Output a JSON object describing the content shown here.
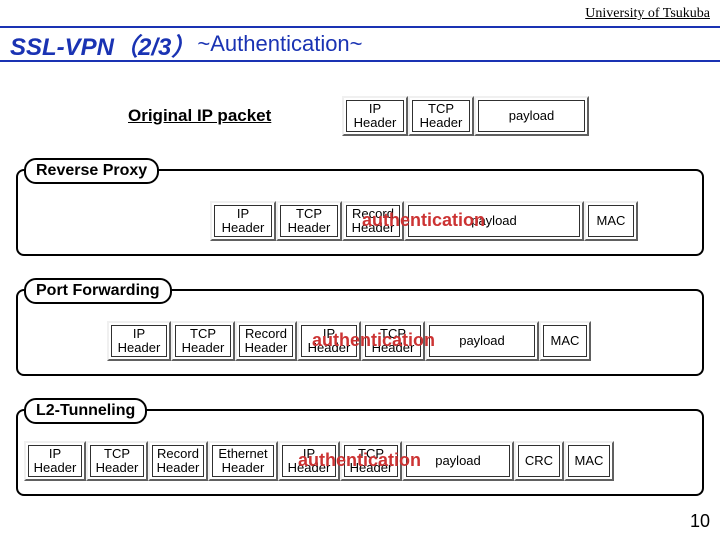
{
  "university": "University of Tsukuba",
  "title_main": "SSL-VPN",
  "title_part": "（2/3）",
  "title_sub": "~Authentication~",
  "page_number": "10",
  "original_label": "Original  IP packet",
  "cells": {
    "ip": "IP Header",
    "tcp": "TCP Header",
    "payload": "payload",
    "record": "Record Header",
    "mac": "MAC",
    "eth": "Ethernet Header",
    "crc": "CRC"
  },
  "sections": {
    "reverse": "Reverse Proxy",
    "port": "Port Forwarding",
    "l2": "L2‑Tunneling"
  },
  "auth_label": "authentication"
}
